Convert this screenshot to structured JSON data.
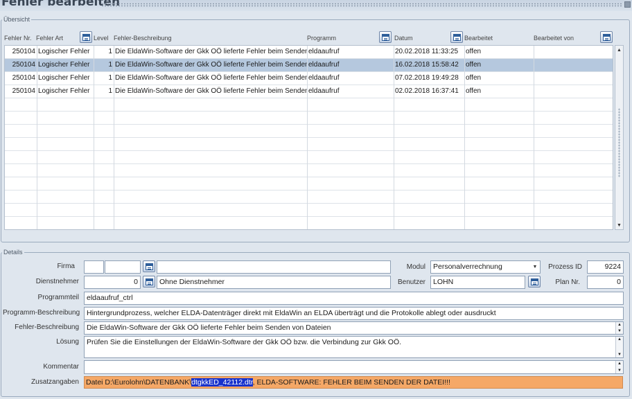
{
  "window": {
    "title": "Fehler bearbeiten"
  },
  "overview": {
    "legend": "Übersicht",
    "columns": {
      "fehler_nr": "Fehler Nr.",
      "fehler_art": "Fehler Art",
      "level": "Level",
      "beschreibung": "Fehler-Beschreibung",
      "programm": "Programm",
      "datum": "Datum",
      "bearbeitet": "Bearbeitet",
      "bearbeitet_von": "Bearbeitet von"
    },
    "rows": [
      {
        "nr": "250104",
        "art": "Logischer Fehler",
        "level": "1",
        "beschreibung": "Die EldaWin-Software der Gkk OÖ lieferte Fehler beim Senden von Dateien",
        "programm": "eldaaufruf",
        "datum": "20.02.2018 11:33:25",
        "bearbeitet": "offen",
        "von": ""
      },
      {
        "nr": "250104",
        "art": "Logischer Fehler",
        "level": "1",
        "beschreibung": "Die EldaWin-Software der Gkk OÖ lieferte Fehler beim Senden von Dateien",
        "programm": "eldaaufruf",
        "datum": "16.02.2018 15:58:42",
        "bearbeitet": "offen",
        "von": ""
      },
      {
        "nr": "250104",
        "art": "Logischer Fehler",
        "level": "1",
        "beschreibung": "Die EldaWin-Software der Gkk OÖ lieferte Fehler beim Senden von Dateien",
        "programm": "eldaaufruf",
        "datum": "07.02.2018 19:49:28",
        "bearbeitet": "offen",
        "von": ""
      },
      {
        "nr": "250104",
        "art": "Logischer Fehler",
        "level": "1",
        "beschreibung": "Die EldaWin-Software der Gkk OÖ lieferte Fehler beim Senden von Dateien",
        "programm": "eldaaufruf",
        "datum": "02.02.2018 16:37:41",
        "bearbeitet": "offen",
        "von": ""
      }
    ],
    "selected_row": 1
  },
  "details": {
    "legend": "Details",
    "labels": {
      "firma": "Firma",
      "dienstnehmer": "Dienstnehmer",
      "programmteil": "Programmteil",
      "programm_beschreibung": "Programm-Beschreibung",
      "fehler_beschreibung": "Fehler-Beschreibung",
      "loesung": "Lösung",
      "kommentar": "Kommentar",
      "zusatzangaben": "Zusatzangaben",
      "modul": "Modul",
      "benutzer": "Benutzer",
      "prozess_id": "Prozess ID",
      "plan_nr": "Plan Nr."
    },
    "values": {
      "firma_1": "",
      "firma_2": "",
      "firma_name": "",
      "dienstnehmer_nr": "0",
      "dienstnehmer_name": "Ohne Dienstnehmer",
      "programmteil": "eldaaufruf_ctrl",
      "programm_beschreibung": "Hintergrundprozess, welcher ELDA-Datenträger direkt mit EldaWin an ELDA überträgt und die Protokolle ablegt oder ausdruckt",
      "fehler_beschreibung": "Die EldaWin-Software der Gkk OÖ lieferte Fehler beim Senden von Dateien",
      "loesung": "Prüfen Sie die Einstellungen der EldaWin-Software der Gkk OÖ bzw. die Verbindung zur Gkk OÖ.",
      "kommentar": "",
      "modul": "Personalverrechnung",
      "benutzer": "LOHN",
      "prozess_id": "9224",
      "plan_nr": "0",
      "zusatz_prefix": "Datei D:\\Eurolohn\\DATENBANK\\",
      "zusatz_highlight": "dtgkkED_42112.dtr",
      "zusatz_suffix": ", ELDA-SOFTWARE: FEHLER BEIM SENDEN DER DATEI!!!"
    }
  },
  "icons": {
    "calendar": "calendar-icon",
    "scroll_up": "▲",
    "scroll_down": "▼",
    "dropdown": "▼"
  },
  "colors": {
    "selected_row": "#b5c8de",
    "zusatz_bg": "#f5a867",
    "highlight": "#1832cc"
  }
}
